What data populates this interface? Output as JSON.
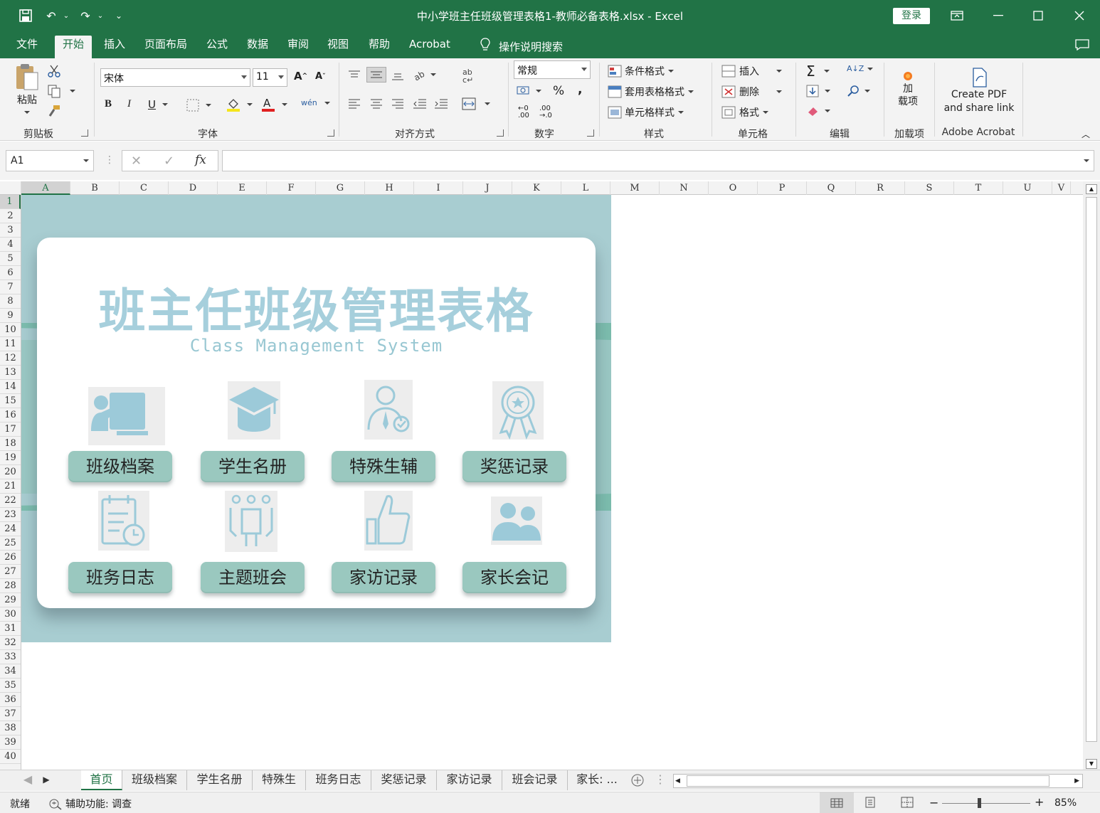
{
  "window": {
    "title": "中小学班主任班级管理表格1-教师必备表格.xlsx  -  Excel",
    "login_label": "登录"
  },
  "ribbon_tabs": [
    {
      "label": "文件"
    },
    {
      "label": "开始"
    },
    {
      "label": "插入"
    },
    {
      "label": "页面布局"
    },
    {
      "label": "公式"
    },
    {
      "label": "数据"
    },
    {
      "label": "审阅"
    },
    {
      "label": "视图"
    },
    {
      "label": "帮助"
    },
    {
      "label": "Acrobat"
    },
    {
      "label": "操作说明搜索"
    }
  ],
  "active_tab": "开始",
  "ribbon": {
    "clipboard": {
      "paste_label": "粘贴",
      "group_label": "剪贴板"
    },
    "font": {
      "font_name": "宋体",
      "font_size": "11",
      "group_label": "字体",
      "bold": "B",
      "italic": "I",
      "underline": "U"
    },
    "alignment": {
      "group_label": "对齐方式"
    },
    "number": {
      "format": "常规",
      "percent": "%",
      "comma": ",",
      "group_label": "数字"
    },
    "styles": {
      "conditional": "条件格式",
      "table": "套用表格格式",
      "cell": "单元格样式",
      "group_label": "样式"
    },
    "cells": {
      "insert": "插入",
      "delete": "删除",
      "format": "格式",
      "group_label": "单元格"
    },
    "editing": {
      "group_label": "编辑"
    },
    "addins": {
      "label_line1": "加",
      "label_line2": "载项",
      "group_label": "加载项"
    },
    "acrobat": {
      "line1": "Create PDF",
      "line2": "and share link",
      "group_label": "Adobe Acrobat"
    }
  },
  "formula_bar": {
    "name_box": "A1",
    "fx": "fx",
    "formula": ""
  },
  "columns": [
    "A",
    "B",
    "C",
    "D",
    "E",
    "F",
    "G",
    "H",
    "I",
    "J",
    "K",
    "L",
    "M",
    "N",
    "O",
    "P",
    "Q",
    "R",
    "S",
    "T",
    "U",
    "V"
  ],
  "rows": [
    "1",
    "2",
    "3",
    "4",
    "5",
    "6",
    "7",
    "8",
    "9",
    "10",
    "11",
    "12",
    "13",
    "14",
    "15",
    "16",
    "17",
    "18",
    "19",
    "20",
    "21",
    "22",
    "23",
    "24",
    "25",
    "26",
    "27",
    "28",
    "29",
    "30",
    "31",
    "32",
    "33",
    "34",
    "35",
    "36",
    "37",
    "38",
    "39",
    "40"
  ],
  "dashboard": {
    "title": "班主任班级管理表格",
    "subtitle": "Class  Management System",
    "tiles": [
      {
        "label": "班级档案",
        "icon": "teacher-board-icon"
      },
      {
        "label": "学生名册",
        "icon": "graduation-cap-icon"
      },
      {
        "label": "特殊生辅",
        "icon": "user-check-icon"
      },
      {
        "label": "奖惩记录",
        "icon": "award-ribbon-icon"
      },
      {
        "label": "班务日志",
        "icon": "calendar-clock-icon"
      },
      {
        "label": "主题班会",
        "icon": "meeting-table-icon"
      },
      {
        "label": "家访记录",
        "icon": "thumbs-up-icon"
      },
      {
        "label": "家长会记",
        "icon": "parents-icon"
      }
    ],
    "colors": {
      "background": "#a8cdd1",
      "band": "#7cbdae",
      "title": "#a6cfdc",
      "button": "#9ac8bf"
    }
  },
  "sheet_tabs": [
    {
      "label": "首页"
    },
    {
      "label": "班级档案"
    },
    {
      "label": "学生名册"
    },
    {
      "label": "特殊生"
    },
    {
      "label": "班务日志"
    },
    {
      "label": "奖惩记录"
    },
    {
      "label": "家访记录"
    },
    {
      "label": "班会记录"
    },
    {
      "label": "家长: ..."
    }
  ],
  "status_bar": {
    "ready": "就绪",
    "accessibility": "辅助功能: 调查",
    "zoom": "85%"
  }
}
